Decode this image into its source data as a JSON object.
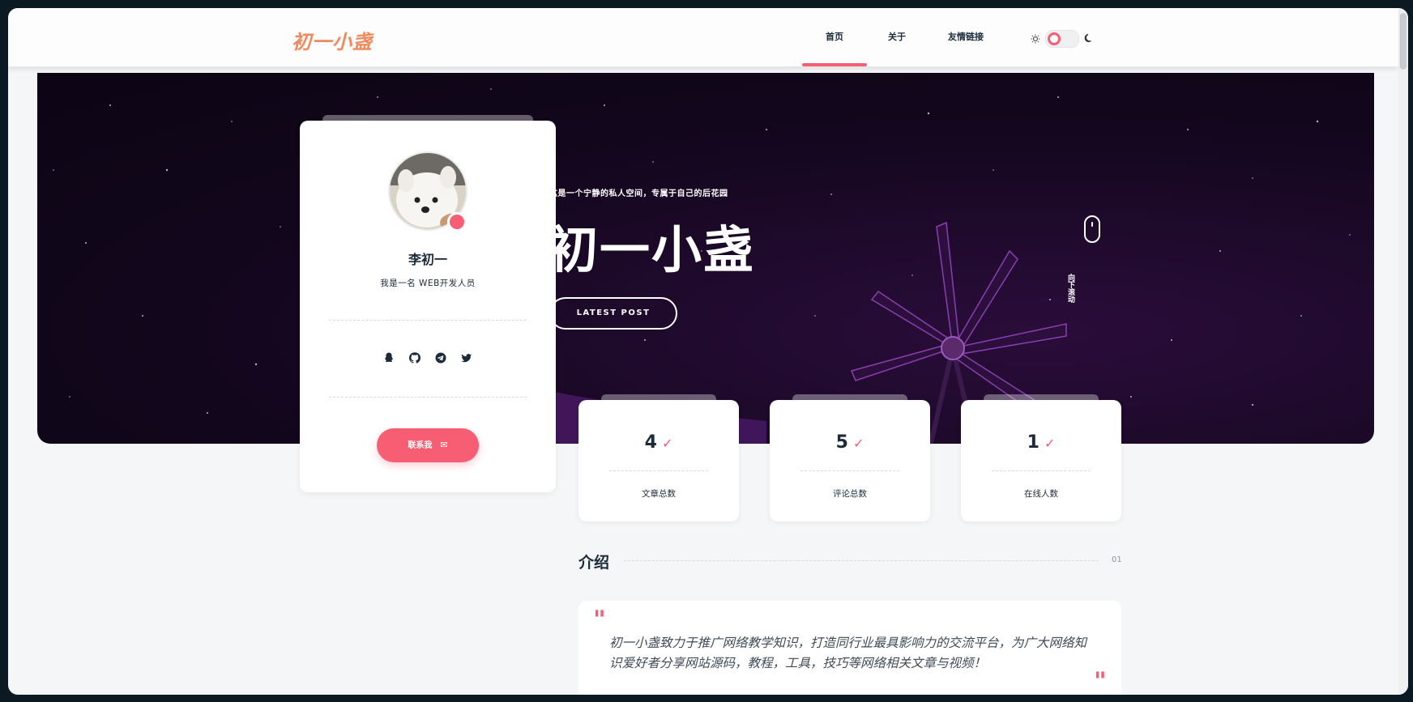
{
  "header": {
    "logo": "初一小盏",
    "nav": [
      {
        "label": "首页"
      },
      {
        "label": "关于"
      },
      {
        "label": "友情链接"
      }
    ]
  },
  "hero": {
    "subtitle": "这是一个宁静的私人空间，专属于自己的后花园",
    "title": "初一小盏",
    "button_label": "LATEST POST",
    "scroll_text": "向下滚动"
  },
  "profile": {
    "name": "李初一",
    "bio": "我是一名 WEB开发人员",
    "social_icons": [
      "qq-icon",
      "github-icon",
      "telegram-icon",
      "twitter-icon"
    ],
    "contact_label": "联系我"
  },
  "stats": [
    {
      "value": "4",
      "label": "文章总数"
    },
    {
      "value": "5",
      "label": "评论总数"
    },
    {
      "value": "1",
      "label": "在线人数"
    }
  ],
  "intro": {
    "title": "介绍",
    "number": "01",
    "quote": "初一小盏致力于推广网络教学知识，打造同行业最具影响力的交流平台，为广大网络知识爱好者分享网站源码，教程，工具，技巧等网络相关文章与视频！"
  },
  "colors": {
    "accent": "#f75e73",
    "text": "#1b2b3a",
    "hero_bg": "#12061c"
  }
}
